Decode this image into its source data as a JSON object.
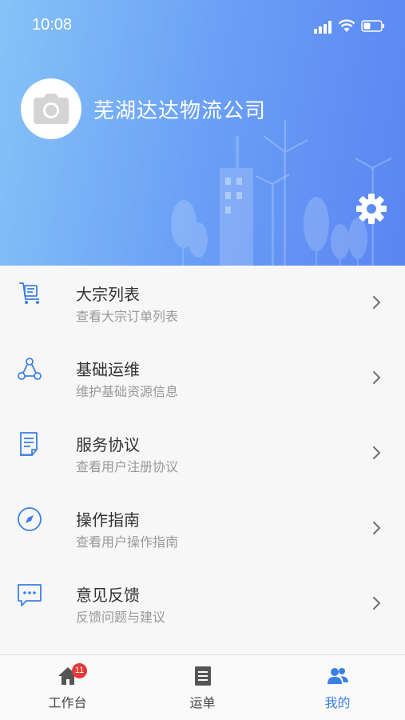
{
  "status_bar": {
    "time": "10:08"
  },
  "profile": {
    "company_name": "芜湖达达物流公司"
  },
  "menu": [
    {
      "title": "大宗列表",
      "subtitle": "查看大宗订单列表",
      "icon": "cart-icon"
    },
    {
      "title": "基础运维",
      "subtitle": "维护基础资源信息",
      "icon": "network-icon"
    },
    {
      "title": "服务协议",
      "subtitle": "查看用户注册协议",
      "icon": "document-icon"
    },
    {
      "title": "操作指南",
      "subtitle": "查看用户操作指南",
      "icon": "compass-icon"
    },
    {
      "title": "意见反馈",
      "subtitle": "反馈问题与建议",
      "icon": "chat-bubble-icon"
    }
  ],
  "tabbar": {
    "tabs": [
      {
        "label": "工作台",
        "icon": "home-icon",
        "badge": "11"
      },
      {
        "label": "运单",
        "icon": "waybill-icon"
      },
      {
        "label": "我的",
        "icon": "people-icon",
        "active": true
      }
    ]
  },
  "colors": {
    "header_start": "#86c3f7",
    "header_end": "#5a85f2",
    "accent": "#3c80e5",
    "badge": "#e53935"
  }
}
